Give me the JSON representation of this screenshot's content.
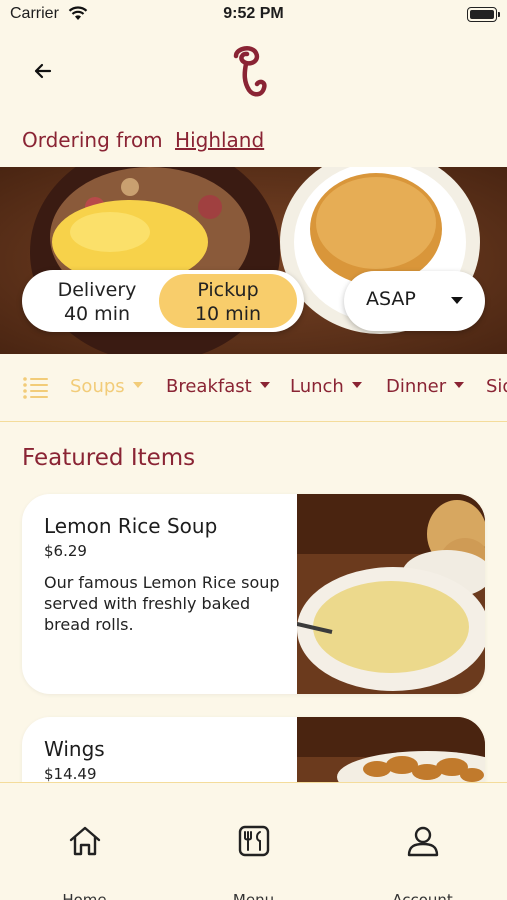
{
  "status_bar": {
    "carrier": "Carrier",
    "time": "9:52 PM"
  },
  "header": {
    "back_icon": "arrow-left-icon",
    "logo": "brand-swirl-logo"
  },
  "ordering": {
    "prefix": "Ordering from",
    "location": "Highland"
  },
  "order_mode": {
    "delivery": {
      "label": "Delivery",
      "time": "40 min"
    },
    "pickup": {
      "label": "Pickup",
      "time": "10 min"
    },
    "selected": "pickup",
    "schedule": "ASAP"
  },
  "categories": {
    "icon": "list-icon",
    "items": [
      {
        "label": "Soups",
        "active": true
      },
      {
        "label": "Breakfast"
      },
      {
        "label": "Lunch"
      },
      {
        "label": "Dinner"
      },
      {
        "label": "Sides"
      }
    ]
  },
  "featured": {
    "title": "Featured Items",
    "items": [
      {
        "name": "Lemon Rice Soup",
        "price": "$6.29",
        "description": "Our famous Lemon Rice soup served with freshly baked bread rolls."
      },
      {
        "name": "Wings",
        "price": "$14.49",
        "description": ""
      }
    ]
  },
  "tab_bar": [
    {
      "label": "Home",
      "icon": "home-icon"
    },
    {
      "label": "Menu",
      "icon": "menu-icon"
    },
    {
      "label": "Account",
      "icon": "account-icon"
    }
  ],
  "colors": {
    "accent": "#8a2434",
    "highlight": "#f8cd6b",
    "background": "#fcf7e8"
  }
}
